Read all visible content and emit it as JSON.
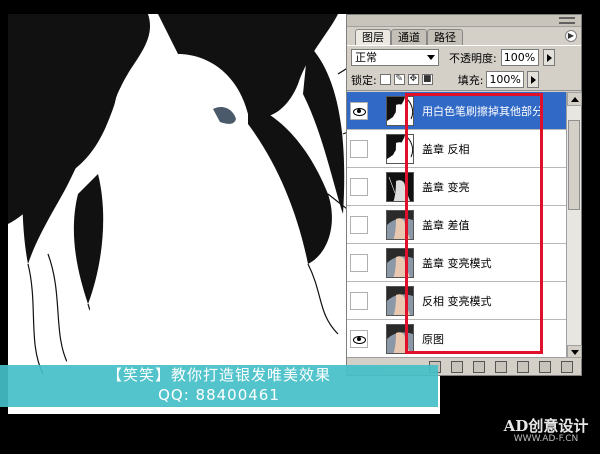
{
  "panel": {
    "tabs": [
      "图层",
      "通道",
      "路径"
    ],
    "active_tab": 0,
    "blend_mode": "正常",
    "opacity_label": "不透明度:",
    "opacity_value": "100%",
    "lock_label": "锁定:",
    "fill_label": "填充:",
    "fill_value": "100%"
  },
  "layers": [
    {
      "name": "用白色笔刷擦掉其他部分",
      "visible": true,
      "selected": true,
      "thumb": "hair-invert"
    },
    {
      "name": "盖章 反相",
      "visible": false,
      "selected": false,
      "thumb": "hair-invert"
    },
    {
      "name": "盖章 变亮",
      "visible": false,
      "selected": false,
      "thumb": "hair-dark"
    },
    {
      "name": "盖章 差值",
      "visible": false,
      "selected": false,
      "thumb": "photo"
    },
    {
      "name": "盖章 变亮模式",
      "visible": false,
      "selected": false,
      "thumb": "photo"
    },
    {
      "name": "反相 变亮模式",
      "visible": false,
      "selected": false,
      "thumb": "photo"
    },
    {
      "name": "原图",
      "visible": true,
      "selected": false,
      "thumb": "photo"
    }
  ],
  "banner": {
    "line1": "【笑笑】教你打造银发唯美效果",
    "line2": "QQ: 88400461"
  },
  "watermark": {
    "logo": "AD创意设计",
    "url": "WWW.AD-F.CN"
  },
  "colors": {
    "highlight": "#e0102a",
    "selection": "#3169c6",
    "banner": "#45bfc8"
  }
}
